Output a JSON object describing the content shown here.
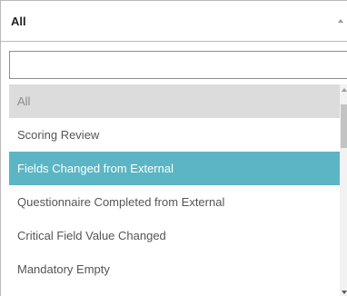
{
  "select": {
    "selected_value": "All",
    "arrow_icon": "triangle-up-icon"
  },
  "search": {
    "value": "",
    "placeholder": ""
  },
  "options": [
    {
      "label": "All",
      "state": "disabled"
    },
    {
      "label": "Scoring Review",
      "state": "normal"
    },
    {
      "label": "Fields Changed from External",
      "state": "highlighted"
    },
    {
      "label": "Questionnaire Completed from External",
      "state": "normal"
    },
    {
      "label": "Critical Field Value Changed",
      "state": "normal"
    },
    {
      "label": "Mandatory Empty",
      "state": "normal"
    }
  ],
  "colors": {
    "highlight": "#5bb5c4",
    "disabled_bg": "#dcdcdc"
  }
}
